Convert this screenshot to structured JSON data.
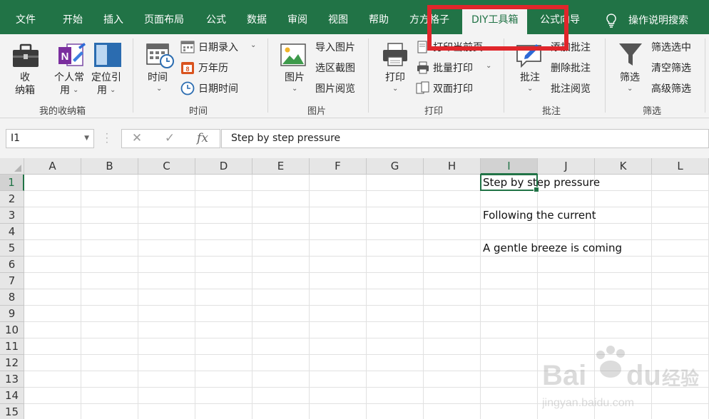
{
  "menu_tabs": [
    {
      "label": "文件"
    },
    {
      "label": "开始"
    },
    {
      "label": "插入"
    },
    {
      "label": "页面布局"
    },
    {
      "label": "公式"
    },
    {
      "label": "数据"
    },
    {
      "label": "审阅"
    },
    {
      "label": "视图"
    },
    {
      "label": "帮助"
    },
    {
      "label": "方方格子"
    },
    {
      "label": "DIY工具箱",
      "active": true
    },
    {
      "label": "公式向导"
    }
  ],
  "tell_me": {
    "label": "操作说明搜索",
    "icon": "lightbulb-icon"
  },
  "ribbon": {
    "collection": {
      "btn1_line1": "收",
      "btn1_line2": "纳箱",
      "btn2_line1": "个人常",
      "btn2_line2": "用",
      "btn3_line1": "定位引",
      "btn3_line2": "用",
      "group_label": "我的收纳箱"
    },
    "time": {
      "big_label": "时间",
      "items": [
        "日期录入",
        "万年历",
        "日期时间"
      ],
      "group_label": "时间"
    },
    "picture": {
      "big_label": "图片",
      "items": [
        "导入图片",
        "选区截图",
        "图片阅览"
      ],
      "group_label": "图片"
    },
    "print": {
      "big_label": "打印",
      "items": [
        "打印当前页",
        "批量打印",
        "双面打印"
      ],
      "group_label": "打印"
    },
    "comment": {
      "big_label": "批注",
      "items": [
        "添加批注",
        "删除批注",
        "批注阅览"
      ],
      "group_label": "批注"
    },
    "filter": {
      "big_label": "筛选",
      "items": [
        "筛选选中",
        "清空筛选",
        "高级筛选"
      ],
      "group_label": "筛选"
    }
  },
  "formula_bar": {
    "name_box": "I1",
    "cancel": "✕",
    "enter": "✓",
    "fx": "fx",
    "content": "Step by step pressure"
  },
  "sheet": {
    "columns": [
      "A",
      "B",
      "C",
      "D",
      "E",
      "F",
      "G",
      "H",
      "I",
      "J",
      "K",
      "L"
    ],
    "rows": [
      "1",
      "2",
      "3",
      "4",
      "5",
      "6",
      "7",
      "8",
      "9",
      "10",
      "11",
      "12",
      "13",
      "14",
      "15"
    ],
    "active_cell": "I1",
    "cells": {
      "I1": "Step by step pressure",
      "I3": "Following the current",
      "I5": "A gentle breeze is coming"
    }
  },
  "watermark": {
    "brand": "Bai",
    "brand2": "du",
    "cn": "经验",
    "url": "jingyan.baidu.com"
  },
  "colors": {
    "accent": "#217346",
    "highlight": "#e0262b"
  }
}
